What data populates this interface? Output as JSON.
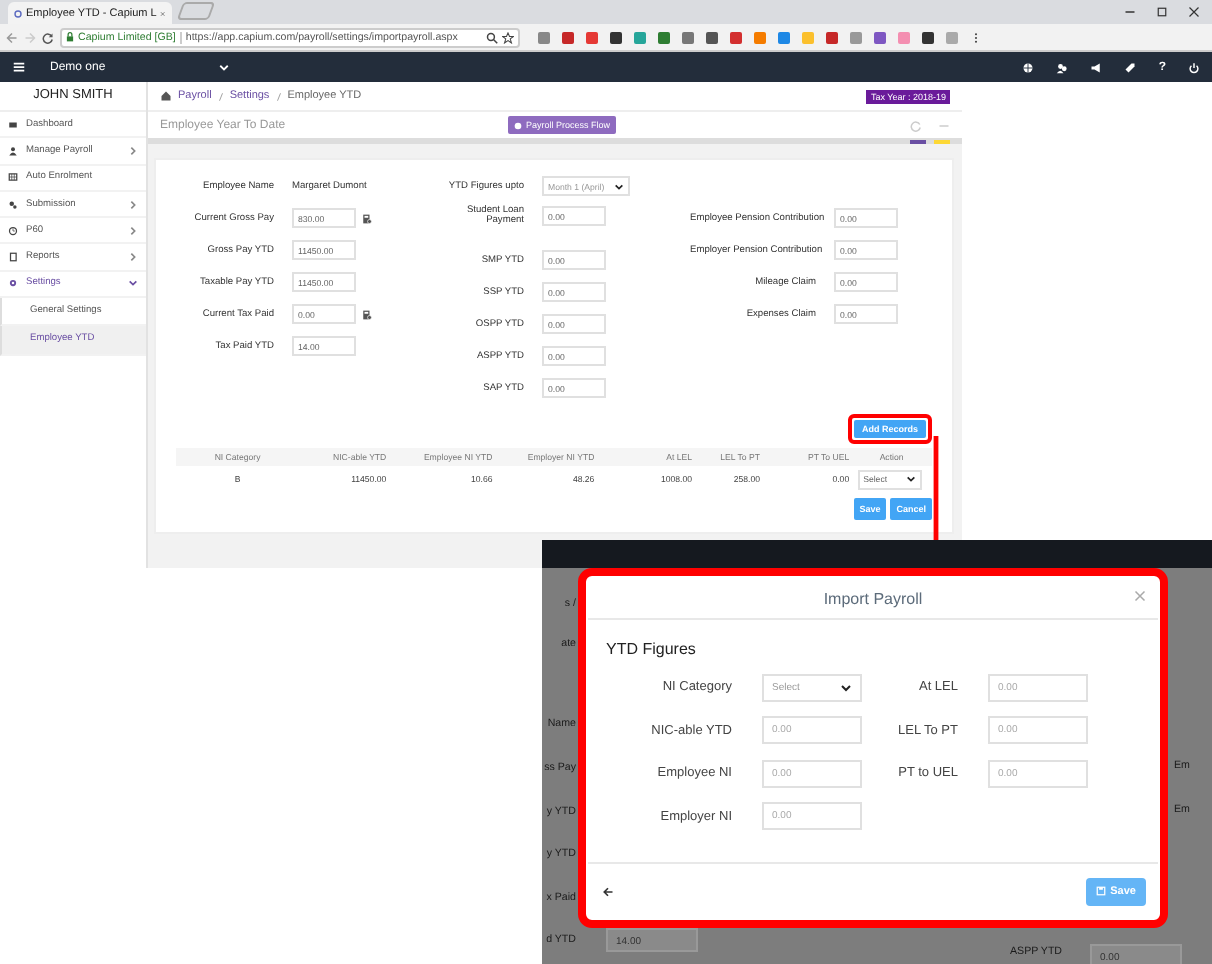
{
  "browser": {
    "tab_title": "Employee YTD - Capium L",
    "site_identity": "Capium Limited [GB]",
    "url": "https://app.capium.com/payroll/settings/importpayroll.aspx"
  },
  "navbar": {
    "company": "Demo one",
    "help": "?"
  },
  "sidebar": {
    "user": "JOHN SMITH",
    "items": [
      {
        "label": "Dashboard",
        "selected": false
      },
      {
        "label": "Manage Payroll",
        "expanded": false,
        "selected": false
      },
      {
        "label": "Auto Enrolment",
        "selected": false
      },
      {
        "label": "Submission",
        "expanded": false,
        "selected": false
      },
      {
        "label": "P60",
        "expanded": false,
        "selected": false
      },
      {
        "label": "Reports",
        "expanded": false,
        "selected": false
      },
      {
        "label": "Settings",
        "expanded": true,
        "selected": true,
        "children": [
          {
            "label": "General Settings",
            "selected": false
          },
          {
            "label": "Employee YTD",
            "selected": true
          }
        ]
      }
    ]
  },
  "breadcrumb": [
    "Payroll",
    "Settings",
    "Employee YTD"
  ],
  "tax_year": "Tax Year : 2018-19",
  "page_title": "Employee Year To Date",
  "flow_button": "Payroll Process Flow",
  "form": {
    "columns": [
      [
        {
          "kind": "text",
          "label": "Employee Name",
          "value": "Margaret Dumont"
        },
        {
          "kind": "calc",
          "label": "Current Gross Pay",
          "value": "830.00"
        },
        {
          "kind": "input",
          "label": "Gross Pay YTD",
          "value": "11450.00"
        },
        {
          "kind": "input",
          "label": "Taxable Pay YTD",
          "value": "11450.00"
        },
        {
          "kind": "calc",
          "label": "Current Tax Paid",
          "value": "0.00"
        },
        {
          "kind": "input",
          "label": "Tax Paid YTD",
          "value": "14.00"
        }
      ],
      [
        {
          "kind": "select",
          "label": "YTD Figures upto",
          "value": "Month 1 (April)"
        },
        {
          "kind": "input",
          "label": "Student Loan Payment",
          "value": "0.00"
        },
        {
          "kind": "input",
          "label": "SMP YTD",
          "value": "0.00"
        },
        {
          "kind": "input",
          "label": "SSP YTD",
          "value": "0.00"
        },
        {
          "kind": "input",
          "label": "OSPP YTD",
          "value": "0.00"
        },
        {
          "kind": "input",
          "label": "ASPP YTD",
          "value": "0.00"
        },
        {
          "kind": "input",
          "label": "SAP YTD",
          "value": "0.00"
        }
      ],
      [
        {
          "kind": "input",
          "label": "Employee Pension Contribution",
          "value": "0.00"
        },
        {
          "kind": "input",
          "label": "Employer Pension Contribution",
          "value": "0.00"
        },
        {
          "kind": "input",
          "label": "Mileage Claim",
          "value": "0.00"
        },
        {
          "kind": "input",
          "label": "Expenses Claim",
          "value": "0.00"
        }
      ]
    ]
  },
  "add_button": "Add Records",
  "table": {
    "columns": [
      "NI Category",
      "NIC-able YTD",
      "Employee NI YTD",
      "Employer NI YTD",
      "At LEL",
      "LEL To PT",
      "PT To UEL",
      "Action"
    ],
    "rows": [
      {
        "cells": [
          "B",
          "11450.00",
          "10.66",
          "48.26",
          "1008.00",
          "258.00",
          "0.00"
        ],
        "action": "Select"
      }
    ]
  },
  "buttons": [
    "Save",
    "Cancel"
  ],
  "inset": {
    "background_labels": [
      "s /",
      "ate",
      "Name",
      "ss Pay",
      "y YTD",
      "y YTD",
      "x Paid",
      "d YTD",
      "Em",
      "Em",
      "ASPP YTD"
    ],
    "background_inputs": [
      "14.00",
      "0.00"
    ],
    "modal": {
      "title": "Import Payroll",
      "section": "YTD Figures",
      "left": [
        {
          "kind": "select",
          "label": "NI Category",
          "placeholder": "Select"
        },
        {
          "kind": "input",
          "label": "NIC-able YTD",
          "placeholder": "0.00"
        },
        {
          "kind": "input",
          "label": "Employee NI",
          "placeholder": "0.00"
        },
        {
          "kind": "input",
          "label": "Employer NI",
          "placeholder": "0.00"
        }
      ],
      "right": [
        {
          "label": "At LEL",
          "placeholder": "0.00"
        },
        {
          "label": "LEL To PT",
          "placeholder": "0.00"
        },
        {
          "label": "PT to UEL",
          "placeholder": "0.00"
        }
      ],
      "save": "Save"
    }
  }
}
